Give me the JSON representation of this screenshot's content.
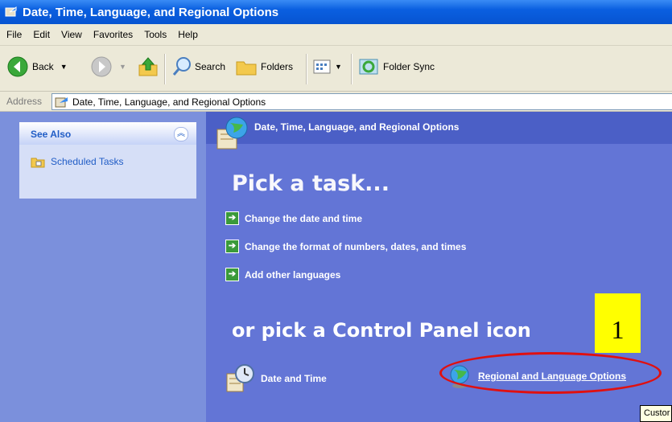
{
  "window": {
    "title": "Date, Time, Language, and Regional Options"
  },
  "menu": [
    "File",
    "Edit",
    "View",
    "Favorites",
    "Tools",
    "Help"
  ],
  "toolbar": {
    "back": "Back",
    "search": "Search",
    "folders": "Folders",
    "folder_sync": "Folder Sync"
  },
  "address": {
    "label": "Address",
    "value": "Date, Time, Language, and Regional Options"
  },
  "sidebar": {
    "see_also_title": "See Also",
    "items": [
      {
        "label": "Scheduled Tasks"
      }
    ]
  },
  "main": {
    "header": "Date, Time, Language, and Regional Options",
    "pick_task": "Pick a task...",
    "tasks": [
      {
        "label": "Change the date and time"
      },
      {
        "label": "Change the format of numbers, dates, and times"
      },
      {
        "label": "Add other languages"
      }
    ],
    "pick_icon": "or pick a Control Panel icon",
    "icons": [
      {
        "label": "Date and Time"
      },
      {
        "label": "Regional and Language Options"
      }
    ]
  },
  "annotation": {
    "number": "1"
  },
  "tooltip": {
    "text": "Custor"
  },
  "colors": {
    "title_bar": "#0754d1",
    "left_pane": "#7b90dc",
    "main_pane": "#6375d6",
    "callout": "#ffff00",
    "highlight_oval": "#e01010"
  }
}
